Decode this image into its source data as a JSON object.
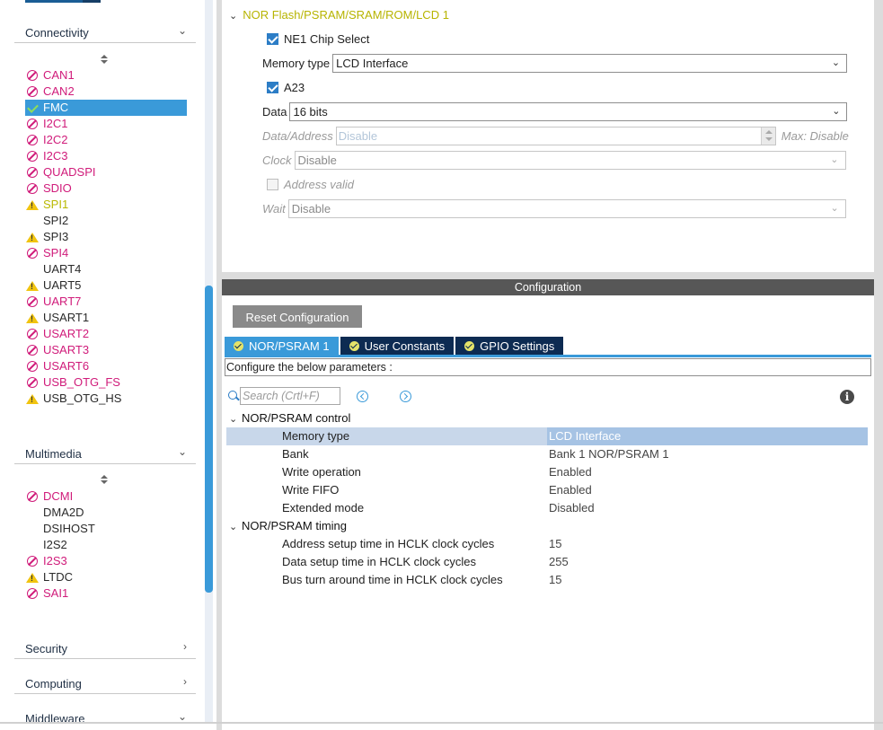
{
  "left": {
    "categories": {
      "connectivity": "Connectivity",
      "multimedia": "Multimedia",
      "security": "Security",
      "computing": "Computing",
      "middleware": "Middleware"
    },
    "connectivity_items": [
      {
        "label": "CAN1",
        "status": "disabled"
      },
      {
        "label": "CAN2",
        "status": "disabled"
      },
      {
        "label": "FMC",
        "status": "selected"
      },
      {
        "label": "I2C1",
        "status": "disabled"
      },
      {
        "label": "I2C2",
        "status": "disabled"
      },
      {
        "label": "I2C3",
        "status": "disabled"
      },
      {
        "label": "QUADSPI",
        "status": "disabled"
      },
      {
        "label": "SDIO",
        "status": "disabled"
      },
      {
        "label": "SPI1",
        "status": "warn-yellow"
      },
      {
        "label": "SPI2",
        "status": "normal"
      },
      {
        "label": "SPI3",
        "status": "warn-normal"
      },
      {
        "label": "SPI4",
        "status": "disabled"
      },
      {
        "label": "UART4",
        "status": "normal"
      },
      {
        "label": "UART5",
        "status": "warn-normal"
      },
      {
        "label": "UART7",
        "status": "disabled"
      },
      {
        "label": "USART1",
        "status": "warn-normal"
      },
      {
        "label": "USART2",
        "status": "disabled"
      },
      {
        "label": "USART3",
        "status": "disabled"
      },
      {
        "label": "USART6",
        "status": "disabled"
      },
      {
        "label": "USB_OTG_FS",
        "status": "disabled"
      },
      {
        "label": "USB_OTG_HS",
        "status": "warn-normal"
      }
    ],
    "multimedia_items": [
      {
        "label": "DCMI",
        "status": "disabled"
      },
      {
        "label": "DMA2D",
        "status": "normal"
      },
      {
        "label": "DSIHOST",
        "status": "normal"
      },
      {
        "label": "I2S2",
        "status": "normal"
      },
      {
        "label": "I2S3",
        "status": "disabled"
      },
      {
        "label": "LTDC",
        "status": "warn-normal"
      },
      {
        "label": "SAI1",
        "status": "disabled"
      }
    ]
  },
  "fmc": {
    "section_title": "NOR Flash/PSRAM/SRAM/ROM/LCD 1",
    "ne1_label": "NE1 Chip Select",
    "memory_type_label": "Memory type",
    "memory_type_value": "LCD Interface",
    "a23_label": "A23",
    "data_label": "Data",
    "data_value": "16 bits",
    "data_address_label": "Data/Address",
    "data_address_value": "Disable",
    "data_address_max": "Max: Disable",
    "clock_label": "Clock",
    "clock_value": "Disable",
    "address_valid_label": "Address valid",
    "wait_label": "Wait",
    "wait_value": "Disable"
  },
  "config": {
    "title": "Configuration",
    "reset_label": "Reset Configuration",
    "tabs": [
      "NOR/PSRAM 1",
      "User Constants",
      "GPIO Settings"
    ],
    "instructions": "Configure the below parameters :",
    "search_placeholder": "Search (Crtl+F)",
    "group1": "NOR/PSRAM control",
    "group2": "NOR/PSRAM timing",
    "control_params": [
      {
        "name": "Memory type",
        "value": "LCD Interface"
      },
      {
        "name": "Bank",
        "value": "Bank 1 NOR/PSRAM 1"
      },
      {
        "name": "Write operation",
        "value": "Enabled"
      },
      {
        "name": "Write FIFO",
        "value": "Enabled"
      },
      {
        "name": "Extended mode",
        "value": "Disabled"
      }
    ],
    "timing_params": [
      {
        "name": "Address setup time in HCLK clock cycles",
        "value": "15"
      },
      {
        "name": "Data setup time in HCLK clock cycles",
        "value": "255"
      },
      {
        "name": "Bus turn around time in HCLK clock cycles",
        "value": "15"
      }
    ]
  },
  "colors": {
    "accent_blue": "#3a9ad9",
    "tab_dark": "#0d2b52",
    "error_magenta": "#d01b7a",
    "warn_yellow": "#f1c40f",
    "section_olive": "#b7b400"
  }
}
